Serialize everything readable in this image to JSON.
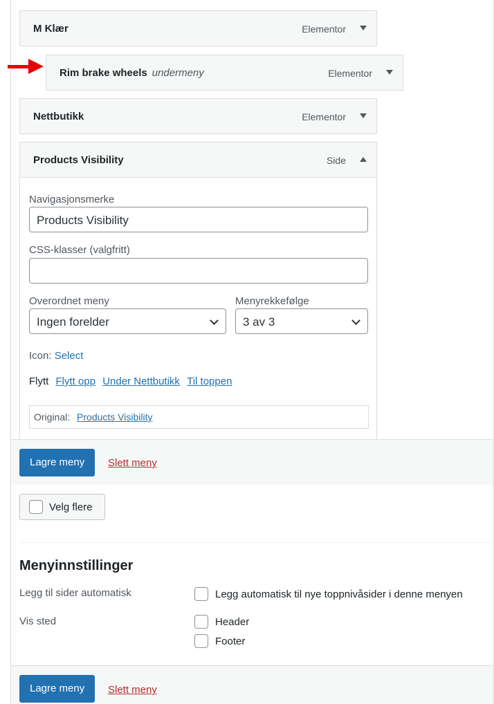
{
  "menu_items": [
    {
      "title": "M Klær",
      "subtitle": "",
      "type": "Elementor"
    },
    {
      "title": "Rim brake wheels",
      "subtitle": "undermeny",
      "type": "Elementor"
    },
    {
      "title": "Nettbutikk",
      "subtitle": "",
      "type": "Elementor"
    },
    {
      "title": "Products Visibility",
      "subtitle": "",
      "type": "Side"
    }
  ],
  "settings": {
    "nav_label": "Navigasjonsmerke",
    "nav_value": "Products Visibility",
    "css_label": "CSS-klasser (valgfritt)",
    "css_value": "",
    "parent_label": "Overordnet meny",
    "parent_value": "Ingen forelder",
    "order_label": "Menyrekkefølge",
    "order_value": "3 av 3",
    "icon_label": "Icon:",
    "icon_link": "Select",
    "move_label": "Flytt",
    "move_up": "Flytt opp",
    "move_under": "Under Nettbutikk",
    "move_top": "Til toppen",
    "original_label": "Original:",
    "original_link": "Products Visibility"
  },
  "actions": {
    "save": "Lagre meny",
    "delete": "Slett meny",
    "select_multiple": "Velg flere"
  },
  "menu_settings": {
    "heading": "Menyinnstillinger",
    "auto_add_label": "Legg til sider automatisk",
    "auto_add_option": "Legg automatisk til nye toppnivåsider i denne menyen",
    "location_label": "Vis sted",
    "locations": [
      "Header",
      "Footer"
    ]
  },
  "colors": {
    "primary": "#2271b1",
    "delete": "#b32d2e",
    "arrow_annotation": "#e60000"
  }
}
